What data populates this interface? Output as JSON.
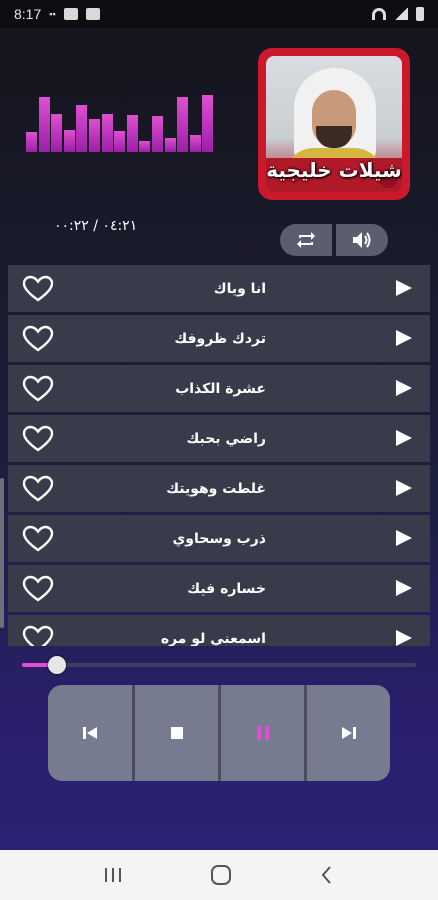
{
  "status_bar": {
    "time": "8:17",
    "left_icons": [
      "notification-icon",
      "image-icon",
      "gallery-icon"
    ],
    "right_icons": [
      "wifi-icon",
      "signal-icon",
      "battery-icon"
    ]
  },
  "album": {
    "title": "شيلات خليجية"
  },
  "playback": {
    "time_display": "٠٤:٢١ / ٠٠:٢٢",
    "progress_fraction": 0.09
  },
  "equalizer": {
    "levels": [
      0.32,
      0.88,
      0.62,
      0.36,
      0.76,
      0.54,
      0.62,
      0.34,
      0.6,
      0.18,
      0.58,
      0.22,
      0.88,
      0.28,
      0.92
    ]
  },
  "controls": {
    "repeat_icon": "repeat-icon",
    "volume_icon": "volume-icon"
  },
  "songs": [
    {
      "title": "انا وياك"
    },
    {
      "title": "تردك ظروفك"
    },
    {
      "title": "عشرة الكذاب"
    },
    {
      "title": "راضي بحبك"
    },
    {
      "title": "غلطت وهويتك"
    },
    {
      "title": "ذرب وسحاوي"
    },
    {
      "title": "خساره فيك"
    },
    {
      "title": "اسمعني لو مره"
    }
  ],
  "player_buttons": [
    "previous-icon",
    "stop-icon",
    "pause-icon",
    "next-icon"
  ],
  "colors": {
    "accent": "#e14ed6",
    "row_bg": "#3a3b4a",
    "cover_border": "#c9192b"
  },
  "nav_bar": [
    "recent-apps-icon",
    "home-icon",
    "back-icon"
  ]
}
